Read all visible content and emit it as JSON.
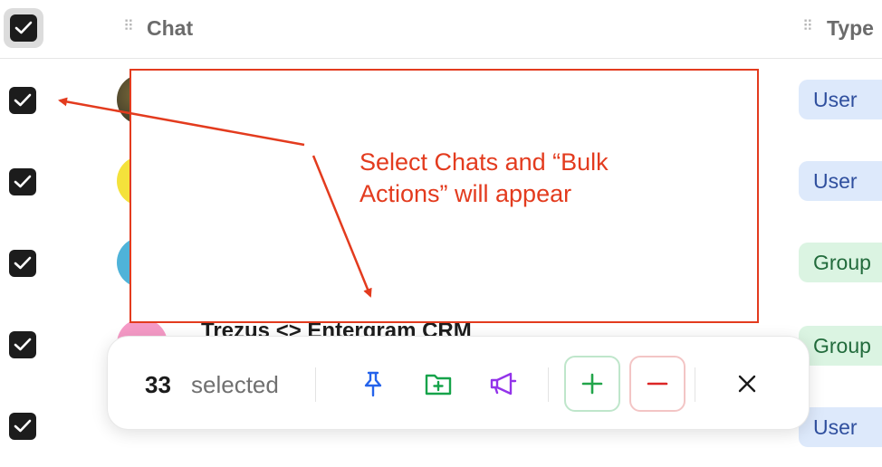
{
  "header": {
    "chat_label": "Chat",
    "type_label": "Type"
  },
  "rows": [
    {
      "type": "User",
      "name": ""
    },
    {
      "type": "User",
      "name": ""
    },
    {
      "type": "Group",
      "name": ""
    },
    {
      "type": "Group",
      "name": "Trezus <> Entergram CRM"
    },
    {
      "type": "User",
      "name": ""
    }
  ],
  "annotation": {
    "text": "Select Chats and “Bulk Actions” will appear"
  },
  "bulk_bar": {
    "count": "33",
    "selected_label": "selected"
  },
  "colors": {
    "annotation": "#e33b1e",
    "pin": "#2563eb",
    "folder": "#16a34a",
    "megaphone": "#9333ea",
    "add": "#22a54a",
    "remove": "#dc2626"
  },
  "icons": [
    "check-icon",
    "drag-handle-icon",
    "pin-icon",
    "folder-plus-icon",
    "megaphone-icon",
    "plus-icon",
    "minus-icon",
    "close-icon"
  ]
}
